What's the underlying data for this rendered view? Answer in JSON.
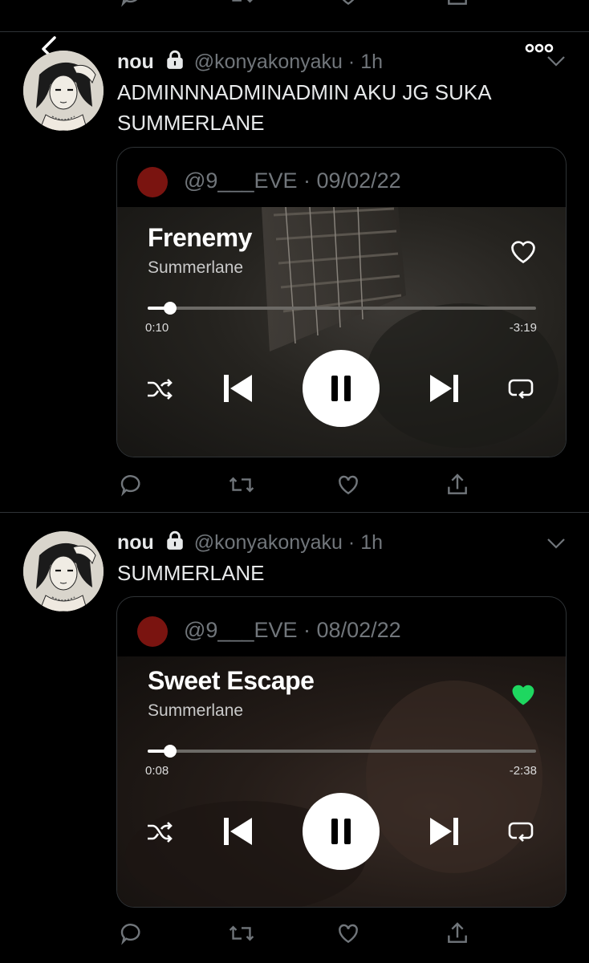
{
  "nav": {
    "back_icon": "chevron-left-icon",
    "more_icon": "ellipsis-icon"
  },
  "tweets": [
    {
      "name": "nou",
      "handle": "@konyakonyaku",
      "dot": "·",
      "time": "1h",
      "text_lines": [
        "ADMINNNADMINADMIN AKU JG SUKA",
        "SUMMERLANE"
      ],
      "card": {
        "handle": "@9___EVE",
        "dot": "·",
        "date": "09/02/22",
        "song": "Frenemy",
        "artist": "Summerlane",
        "elapsed": "0:10",
        "remaining": "-3:19",
        "progress": 0.05,
        "liked": false
      }
    },
    {
      "name": "nou",
      "handle": "@konyakonyaku",
      "dot": "·",
      "time": "1h",
      "text_lines": [
        "SUMMERLANE"
      ],
      "card": {
        "handle": "@9___EVE",
        "dot": "·",
        "date": "08/02/22",
        "song": "Sweet Escape",
        "artist": "Summerlane",
        "elapsed": "0:08",
        "remaining": "-2:38",
        "progress": 0.05,
        "liked": true
      }
    }
  ],
  "colors": {
    "like_green": "#1ed760",
    "card_avatar": "#7a1410",
    "muted": "#71767b"
  },
  "icons": [
    "reply-icon",
    "retweet-icon",
    "like-icon",
    "share-icon",
    "shuffle-icon",
    "previous-icon",
    "pause-icon",
    "next-icon",
    "repeat-icon",
    "heart-icon",
    "lock-icon"
  ]
}
